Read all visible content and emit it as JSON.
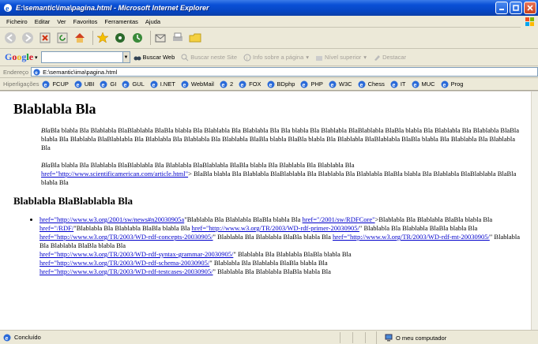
{
  "window": {
    "title": "E:\\semantic\\ima\\pagina.html - Microsoft Internet Explorer"
  },
  "menu": [
    "Ficheiro",
    "Editar",
    "Ver",
    "Favoritos",
    "Ferramentas",
    "Ajuda"
  ],
  "google": {
    "logo": "Google",
    "search_value": "",
    "buscar_web": "Buscar Web",
    "buscar_site": "Buscar neste Site",
    "info": "Info sobre a página",
    "nivel": "Nível superior",
    "destacar": "Destacar"
  },
  "address": {
    "label": "Endereço",
    "value": "E:\\semantic\\ima\\pagina.html"
  },
  "links": {
    "label": "Hiperligações",
    "items": [
      "FCUP",
      "UBI",
      "GI",
      "GUL",
      "I.NET",
      "WebMail",
      "2",
      "FOX",
      "BDphp",
      "PHP",
      "W3C",
      "Chess",
      "IT",
      "MUC",
      "Prog"
    ]
  },
  "content": {
    "heading1": "Blablabla Bla",
    "para1_italic": "Bla",
    "para1_text": "Bla blabla Bla Blablabla BlaBlablabla BlaBla blabla Bla Blablabla Bla Blablabla Bla Bla blabla Bla Blablabla BlaBlablabla BlaBla blabla Bla Blablabla Bla Blablabla BlaBla blabla Bla Blablabla BlaBlablabla Bla Blablabla Bla Blablabla Bla Blablabla BlaBla blabla BlaBla blabla Bla Blablabla BlaBlablabla BlaBla blabla Bla Blablabla Bla Blablabla Bla",
    "para2_italic": "Bla",
    "para2_text1": "Bla blabla Bla Blablabla BlaBlablabla Bla Blablabla BlaBlablabla BlaBla blabla Bla Blablabla Bla Blablabla Bla",
    "para2_link": "href=\"http://www.scientificamerican.com/article.html\"",
    "para2_text2": "> BlaBla blabla Bla Blablabla BlaBlablabla Bla Blablabla Bla Blablabla BlaBla blabla Bla Blablabla BlaBlablabla BlaBla blabla Bla",
    "heading2": "Blablabla BlaBlablabla Bla",
    "list": {
      "l1": "href=\"http://www.w3.org/2001/sw/news#n20030905a",
      "t1": "\"Blablabla Bla Blablabla BlaBla blabla Bla ",
      "l2": "href=\"/2001/sw/RDFCore\"",
      "t2": ">Blablabla Bla Blablabla BlaBla blabla Bla ",
      "l3": "href=\"/RDF/",
      "t3": "\"Blablabla Bla Blablabla BlaBla blabla Bla ",
      "l4": "href=\"http://www.w3.org/TR/2003/WD-rdf-primer-20030905/",
      "t4": "\" Blablabla Bla Blablabla BlaBla blabla Bla ",
      "l5": "href=\"http://www.w3.org/TR/2003/WD-rdf-concepts-20030905/",
      "t5": "\" Blablabla Bla Blablabla BlaBla blabla Bla ",
      "l6": "href=\"http://www.w3.org/TR/2003/WD-rdf-mt-20030905/",
      "t6": "\" Blablabla Bla Blablabla BlaBla blabla Bla ",
      "l7": "href=\"http://www.w3.org/TR/2003/WD-rdf-syntax-grammar-20030905/",
      "t7": "\" Blablabla Bla Blablabla BlaBla blabla Bla ",
      "l8": "href=\"http://www.w3.org/TR/2003/WD-rdf-schema-20030905/",
      "t8": "\" Blablabla Bla Blablabla BlaBla blabla Bla ",
      "l9": "href=\"http://www.w3.org/TR/2003/WD-rdf-testcases-20030905/",
      "t9": "\" Blablabla Bla Blablabla BlaBla blabla Bla"
    }
  },
  "status": {
    "left": "Concluído",
    "zone": "O meu computador"
  },
  "colors": {
    "titlebar": "#0646c4",
    "link": "#0000cc",
    "chrome": "#ece9d8"
  }
}
